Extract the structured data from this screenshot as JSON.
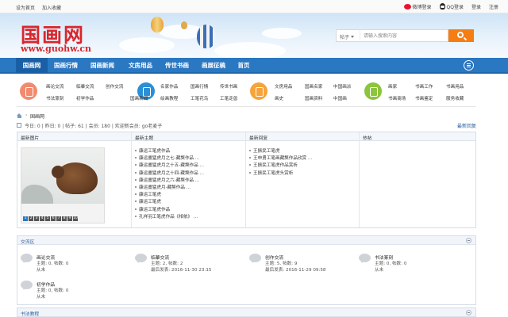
{
  "topbar": {
    "set_home": "设为首页",
    "add_fav": "加入收藏",
    "weibo_login": "微博登录",
    "qq_login": "QQ登录",
    "login": "登录",
    "register": "注册"
  },
  "header": {
    "logo_cn": "国画网",
    "logo_url": "www.guohw.cn",
    "search_type": "帖子",
    "search_placeholder": "请输入搜索内容"
  },
  "nav": {
    "items": [
      "国画网",
      "国画行情",
      "国画新闻",
      "文房用品",
      "传世书画",
      "画展征稿",
      "首页"
    ]
  },
  "categories": {
    "colors": [
      "#f28a6e",
      "#2a8fd6",
      "#f6a43a",
      "#8cc43c"
    ],
    "group1": [
      "画论交流",
      "临摹交流",
      "创作交流",
      "书法篆刻",
      "初学作品"
    ],
    "group2": [
      "名家作品",
      "国画行情",
      "传世书画",
      "绘画教程",
      "国画新闻",
      "工笔花鸟",
      "工笔走兽"
    ],
    "group3": [
      "文房用品",
      "国画名家",
      "中国画派",
      "画史",
      "国画资料",
      "中国画"
    ],
    "group4": [
      "画家",
      "书画工作",
      "书画用品",
      "书画商场",
      "书画鉴定",
      "服务收藏"
    ]
  },
  "breadcrumb": {
    "sep": "›",
    "current": "国画网"
  },
  "stats": {
    "text": "今日: 0 | 昨日: 0 | 帖子: 61 | 会员: 180 | 欢迎新会员: go老麦子",
    "latest_reply": "最新回复"
  },
  "portal": {
    "heads": [
      "最新图片",
      "最新主题",
      "最新回复",
      "热帖"
    ],
    "pager": [
      "1",
      "2",
      "3",
      "4",
      "5",
      "6",
      "7",
      "8",
      "9",
      "10"
    ],
    "latest_topics": [
      "康运工笔虎作品",
      "康运畫猛虎月之七-藏獒作品 ...",
      "康运畫猛虎月之十五-藏獒作品 ...",
      "康运畫猛虎月之十四-藏獒作品 ...",
      "康运畫猛虎月之六-藏獒作品 ...",
      "康运畫猛虎月-藏獒作品 ...",
      "康运工笔虎",
      "康运工笔虎",
      "康运工笔虎作品",
      "孔祥羽工笔虎作品《相依》 ..."
    ],
    "latest_replies": [
      "王振民工笔虎",
      "王申勇工笔画藏獒作品欣赏 ...",
      "王振民工笔虎作品赏析",
      "王振民工笔虎头赏析"
    ]
  },
  "section1": {
    "title": "交流区",
    "forums": [
      {
        "name": "画论交流",
        "meta": "主题: 0, 帖数: 0",
        "meta2": "从未"
      },
      {
        "name": "临摹交流",
        "meta": "主题: 2, 帖数: 2",
        "meta2": "最后发表: 2016-11-30 23:15"
      },
      {
        "name": "创作交流",
        "meta": "主题: 5, 帖数: 9",
        "meta2": "最后发表: 2016-11-29 09:58"
      },
      {
        "name": "书法篆刻",
        "meta": "主题: 0, 帖数: 0",
        "meta2": "从未"
      },
      {
        "name": "初学作品",
        "meta": "主题: 0, 帖数: 0",
        "meta2": "从未"
      }
    ]
  },
  "section2": {
    "title": "书法教程"
  }
}
